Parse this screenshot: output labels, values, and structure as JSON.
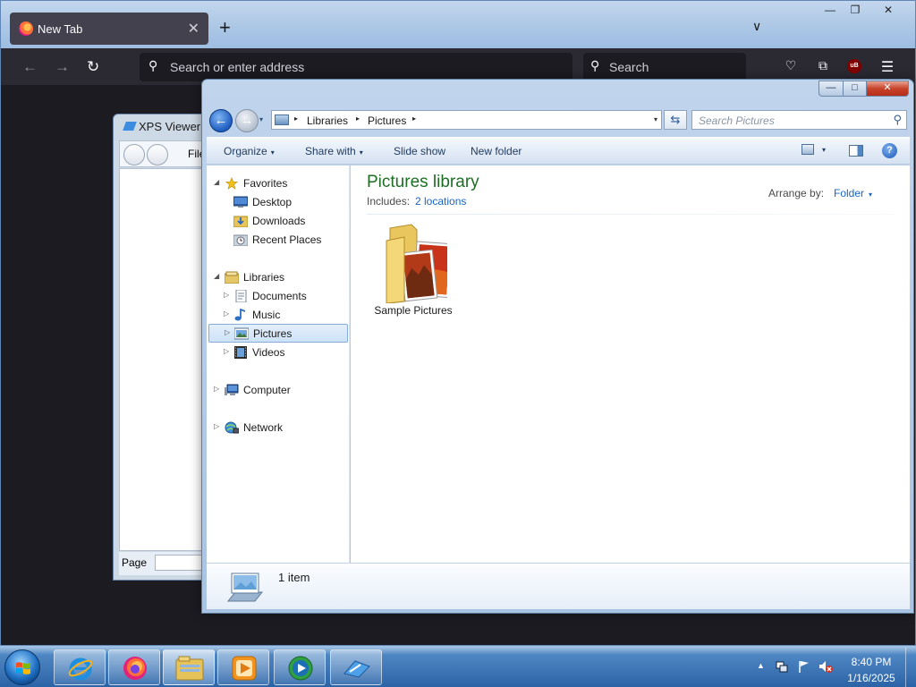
{
  "firefox": {
    "tab_title": "New Tab",
    "tab_close": "✕",
    "new_tab": "+",
    "list_tabs": "∨",
    "caption": {
      "minimize": "—",
      "maximize": "❐",
      "close": "✕"
    },
    "nav": {
      "back": "←",
      "forward": "→",
      "reload": "↻"
    },
    "address_placeholder": "Search or enter address",
    "search_placeholder": "Search",
    "search_glyph": "⚲",
    "ublock_badge": "uB",
    "menu_glyph": "☰",
    "ext_glyph": "⧉",
    "pocket_glyph": "♡"
  },
  "xps_viewer": {
    "title": "XPS Viewer",
    "menu_file": "File",
    "page_label": "Page"
  },
  "explorer": {
    "caption": {
      "minimize": "—",
      "maximize": "□",
      "close": "✕"
    },
    "back_glyph": "←",
    "forward_glyph": "→",
    "recent_glyph": "▾",
    "address": {
      "crumbs": [
        "Libraries",
        "Pictures"
      ],
      "sep": "▸",
      "dropdown": "▾"
    },
    "refresh_glyph": "⇆",
    "search_placeholder": "Search Pictures",
    "search_glyph": "⚲",
    "toolbar": {
      "organize": "Organize",
      "share_with": "Share with",
      "slide_show": "Slide show",
      "new_folder": "New folder",
      "caret": "▾",
      "help": "?"
    },
    "nav_pane": {
      "favorites": "Favorites",
      "desktop": "Desktop",
      "downloads": "Downloads",
      "recent_places": "Recent Places",
      "libraries": "Libraries",
      "documents": "Documents",
      "music": "Music",
      "pictures": "Pictures",
      "videos": "Videos",
      "computer": "Computer",
      "network": "Network",
      "expanded": "◢",
      "collapsed": "▷"
    },
    "library": {
      "title": "Pictures library",
      "includes_label": "Includes:",
      "locations_link": "2 locations",
      "arrange_label": "Arrange by:",
      "arrange_value": "Folder",
      "arrange_caret": "▾"
    },
    "items": [
      {
        "name": "Sample Pictures",
        "type": "folder"
      }
    ],
    "status": {
      "count": "1 item"
    }
  },
  "taskbar": {
    "pinned": [
      "internet-explorer",
      "firefox",
      "windows-explorer",
      "media-player",
      "media-center",
      "xps-viewer"
    ],
    "tray_up": "▲",
    "clock": {
      "time": "8:40 PM",
      "date": "1/16/2025"
    }
  },
  "colors": {
    "firefox_toolbar": "#2b2a33",
    "explorer_frame": "#a9c3e3",
    "library_title": "#1e6e24",
    "link": "#1c63c3",
    "taskbar": "#2a63a6"
  }
}
